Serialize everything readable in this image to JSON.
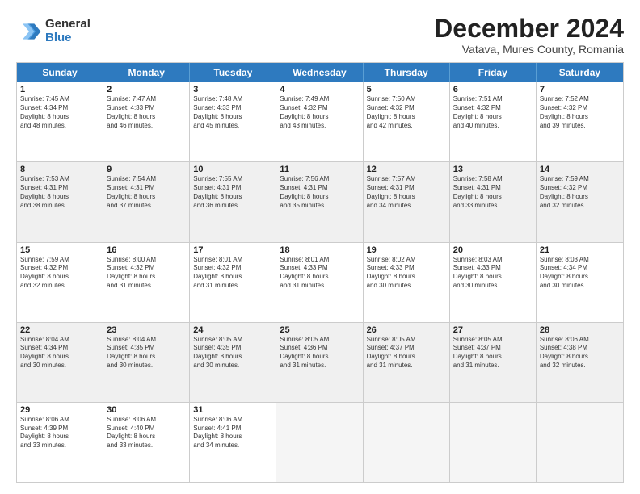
{
  "logo": {
    "general": "General",
    "blue": "Blue"
  },
  "title": "December 2024",
  "subtitle": "Vatava, Mures County, Romania",
  "header_days": [
    "Sunday",
    "Monday",
    "Tuesday",
    "Wednesday",
    "Thursday",
    "Friday",
    "Saturday"
  ],
  "weeks": [
    [
      {
        "day": "1",
        "lines": [
          "Sunrise: 7:45 AM",
          "Sunset: 4:34 PM",
          "Daylight: 8 hours",
          "and 48 minutes."
        ]
      },
      {
        "day": "2",
        "lines": [
          "Sunrise: 7:47 AM",
          "Sunset: 4:33 PM",
          "Daylight: 8 hours",
          "and 46 minutes."
        ]
      },
      {
        "day": "3",
        "lines": [
          "Sunrise: 7:48 AM",
          "Sunset: 4:33 PM",
          "Daylight: 8 hours",
          "and 45 minutes."
        ]
      },
      {
        "day": "4",
        "lines": [
          "Sunrise: 7:49 AM",
          "Sunset: 4:32 PM",
          "Daylight: 8 hours",
          "and 43 minutes."
        ]
      },
      {
        "day": "5",
        "lines": [
          "Sunrise: 7:50 AM",
          "Sunset: 4:32 PM",
          "Daylight: 8 hours",
          "and 42 minutes."
        ]
      },
      {
        "day": "6",
        "lines": [
          "Sunrise: 7:51 AM",
          "Sunset: 4:32 PM",
          "Daylight: 8 hours",
          "and 40 minutes."
        ]
      },
      {
        "day": "7",
        "lines": [
          "Sunrise: 7:52 AM",
          "Sunset: 4:32 PM",
          "Daylight: 8 hours",
          "and 39 minutes."
        ]
      }
    ],
    [
      {
        "day": "8",
        "lines": [
          "Sunrise: 7:53 AM",
          "Sunset: 4:31 PM",
          "Daylight: 8 hours",
          "and 38 minutes."
        ]
      },
      {
        "day": "9",
        "lines": [
          "Sunrise: 7:54 AM",
          "Sunset: 4:31 PM",
          "Daylight: 8 hours",
          "and 37 minutes."
        ]
      },
      {
        "day": "10",
        "lines": [
          "Sunrise: 7:55 AM",
          "Sunset: 4:31 PM",
          "Daylight: 8 hours",
          "and 36 minutes."
        ]
      },
      {
        "day": "11",
        "lines": [
          "Sunrise: 7:56 AM",
          "Sunset: 4:31 PM",
          "Daylight: 8 hours",
          "and 35 minutes."
        ]
      },
      {
        "day": "12",
        "lines": [
          "Sunrise: 7:57 AM",
          "Sunset: 4:31 PM",
          "Daylight: 8 hours",
          "and 34 minutes."
        ]
      },
      {
        "day": "13",
        "lines": [
          "Sunrise: 7:58 AM",
          "Sunset: 4:31 PM",
          "Daylight: 8 hours",
          "and 33 minutes."
        ]
      },
      {
        "day": "14",
        "lines": [
          "Sunrise: 7:59 AM",
          "Sunset: 4:32 PM",
          "Daylight: 8 hours",
          "and 32 minutes."
        ]
      }
    ],
    [
      {
        "day": "15",
        "lines": [
          "Sunrise: 7:59 AM",
          "Sunset: 4:32 PM",
          "Daylight: 8 hours",
          "and 32 minutes."
        ]
      },
      {
        "day": "16",
        "lines": [
          "Sunrise: 8:00 AM",
          "Sunset: 4:32 PM",
          "Daylight: 8 hours",
          "and 31 minutes."
        ]
      },
      {
        "day": "17",
        "lines": [
          "Sunrise: 8:01 AM",
          "Sunset: 4:32 PM",
          "Daylight: 8 hours",
          "and 31 minutes."
        ]
      },
      {
        "day": "18",
        "lines": [
          "Sunrise: 8:01 AM",
          "Sunset: 4:33 PM",
          "Daylight: 8 hours",
          "and 31 minutes."
        ]
      },
      {
        "day": "19",
        "lines": [
          "Sunrise: 8:02 AM",
          "Sunset: 4:33 PM",
          "Daylight: 8 hours",
          "and 30 minutes."
        ]
      },
      {
        "day": "20",
        "lines": [
          "Sunrise: 8:03 AM",
          "Sunset: 4:33 PM",
          "Daylight: 8 hours",
          "and 30 minutes."
        ]
      },
      {
        "day": "21",
        "lines": [
          "Sunrise: 8:03 AM",
          "Sunset: 4:34 PM",
          "Daylight: 8 hours",
          "and 30 minutes."
        ]
      }
    ],
    [
      {
        "day": "22",
        "lines": [
          "Sunrise: 8:04 AM",
          "Sunset: 4:34 PM",
          "Daylight: 8 hours",
          "and 30 minutes."
        ]
      },
      {
        "day": "23",
        "lines": [
          "Sunrise: 8:04 AM",
          "Sunset: 4:35 PM",
          "Daylight: 8 hours",
          "and 30 minutes."
        ]
      },
      {
        "day": "24",
        "lines": [
          "Sunrise: 8:05 AM",
          "Sunset: 4:35 PM",
          "Daylight: 8 hours",
          "and 30 minutes."
        ]
      },
      {
        "day": "25",
        "lines": [
          "Sunrise: 8:05 AM",
          "Sunset: 4:36 PM",
          "Daylight: 8 hours",
          "and 31 minutes."
        ]
      },
      {
        "day": "26",
        "lines": [
          "Sunrise: 8:05 AM",
          "Sunset: 4:37 PM",
          "Daylight: 8 hours",
          "and 31 minutes."
        ]
      },
      {
        "day": "27",
        "lines": [
          "Sunrise: 8:05 AM",
          "Sunset: 4:37 PM",
          "Daylight: 8 hours",
          "and 31 minutes."
        ]
      },
      {
        "day": "28",
        "lines": [
          "Sunrise: 8:06 AM",
          "Sunset: 4:38 PM",
          "Daylight: 8 hours",
          "and 32 minutes."
        ]
      }
    ],
    [
      {
        "day": "29",
        "lines": [
          "Sunrise: 8:06 AM",
          "Sunset: 4:39 PM",
          "Daylight: 8 hours",
          "and 33 minutes."
        ]
      },
      {
        "day": "30",
        "lines": [
          "Sunrise: 8:06 AM",
          "Sunset: 4:40 PM",
          "Daylight: 8 hours",
          "and 33 minutes."
        ]
      },
      {
        "day": "31",
        "lines": [
          "Sunrise: 8:06 AM",
          "Sunset: 4:41 PM",
          "Daylight: 8 hours",
          "and 34 minutes."
        ]
      },
      {
        "day": "",
        "lines": []
      },
      {
        "day": "",
        "lines": []
      },
      {
        "day": "",
        "lines": []
      },
      {
        "day": "",
        "lines": []
      }
    ]
  ]
}
